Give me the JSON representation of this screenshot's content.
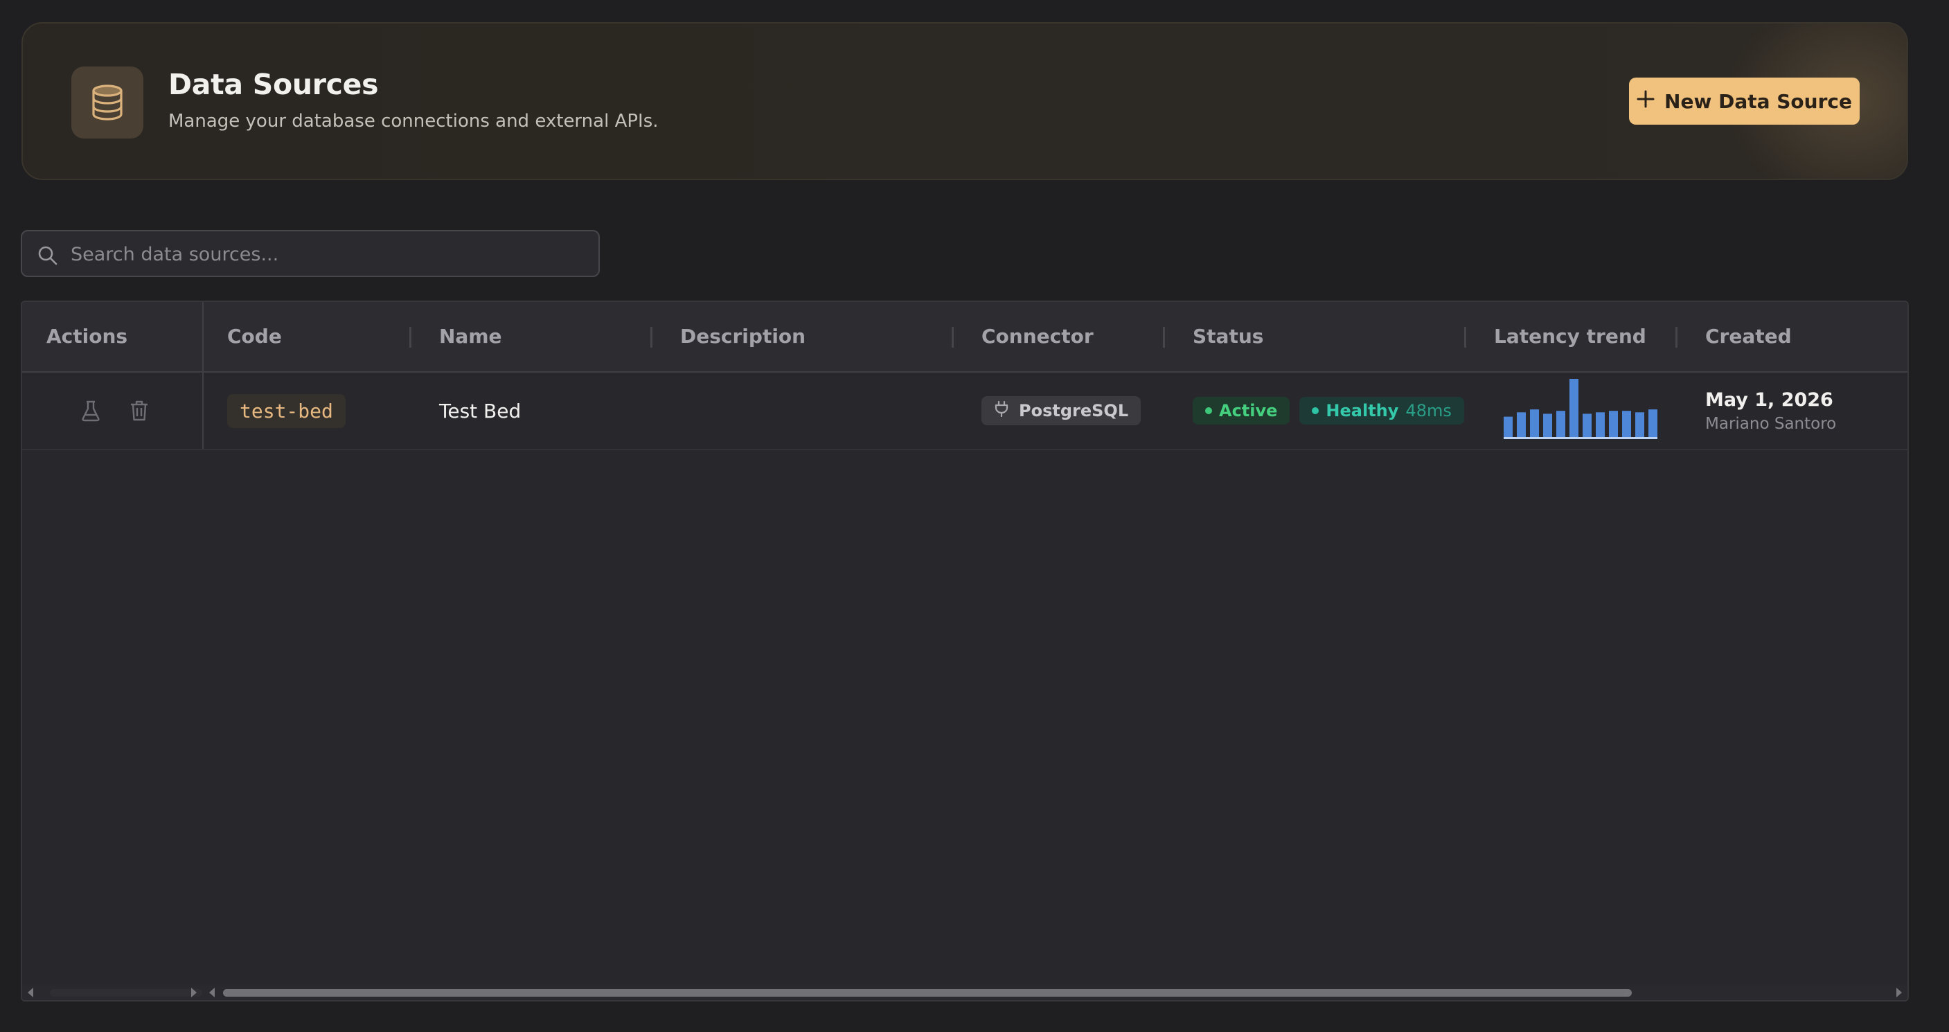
{
  "header": {
    "title": "Data Sources",
    "subtitle": "Manage your database connections and external APIs.",
    "icon": "database-icon",
    "new_button_label": "New Data Source",
    "new_button_icon": "plus-icon",
    "accent_color": "#f0c27e"
  },
  "search": {
    "placeholder": "Search data sources...",
    "value": ""
  },
  "table": {
    "columns": [
      "Actions",
      "Code",
      "Name",
      "Description",
      "Connector",
      "Status",
      "Latency trend",
      "Created"
    ],
    "rows": [
      {
        "actions": [
          "flask-icon",
          "trash-icon"
        ],
        "code": "test-bed",
        "name": "Test Bed",
        "description": "",
        "connector": "PostgreSQL",
        "status": "Active",
        "health": "Healthy",
        "latency": "48ms",
        "latency_trend": [
          14,
          17,
          19,
          16,
          18,
          40,
          16,
          17,
          18,
          18,
          17,
          19
        ],
        "created_date": "May 1, 2026",
        "created_by": "Mariano Santoro"
      }
    ]
  },
  "colors": {
    "active": "#3ec97a",
    "healthy": "#2fc4a6",
    "sparkline": "#4e86d8"
  }
}
